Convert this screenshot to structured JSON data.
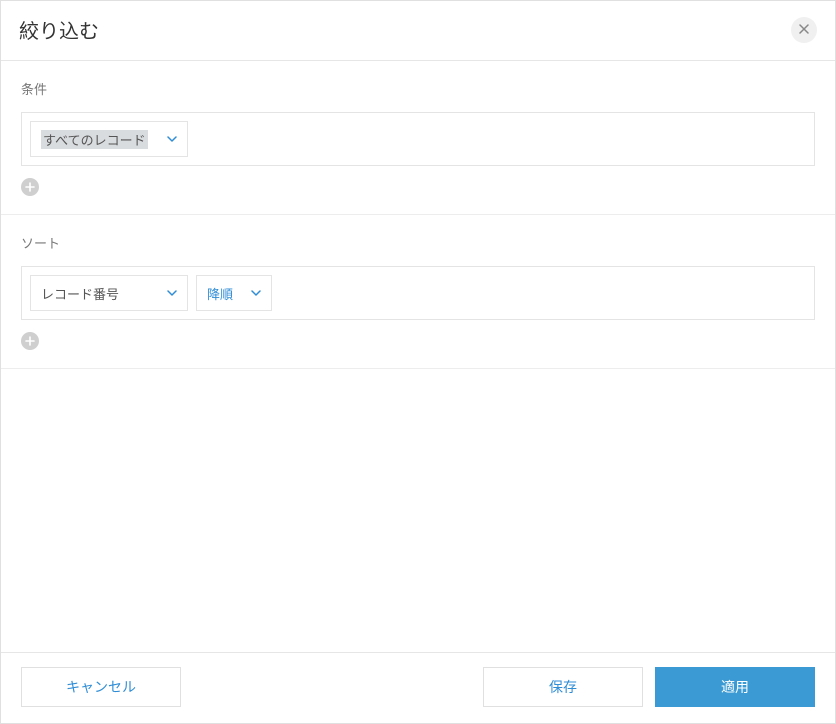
{
  "header": {
    "title": "絞り込む"
  },
  "conditions": {
    "label": "条件",
    "field_selected": "すべてのレコード"
  },
  "sort": {
    "label": "ソート",
    "field_selected": "レコード番号",
    "order_selected": "降順"
  },
  "footer": {
    "cancel": "キャンセル",
    "save": "保存",
    "apply": "適用"
  }
}
